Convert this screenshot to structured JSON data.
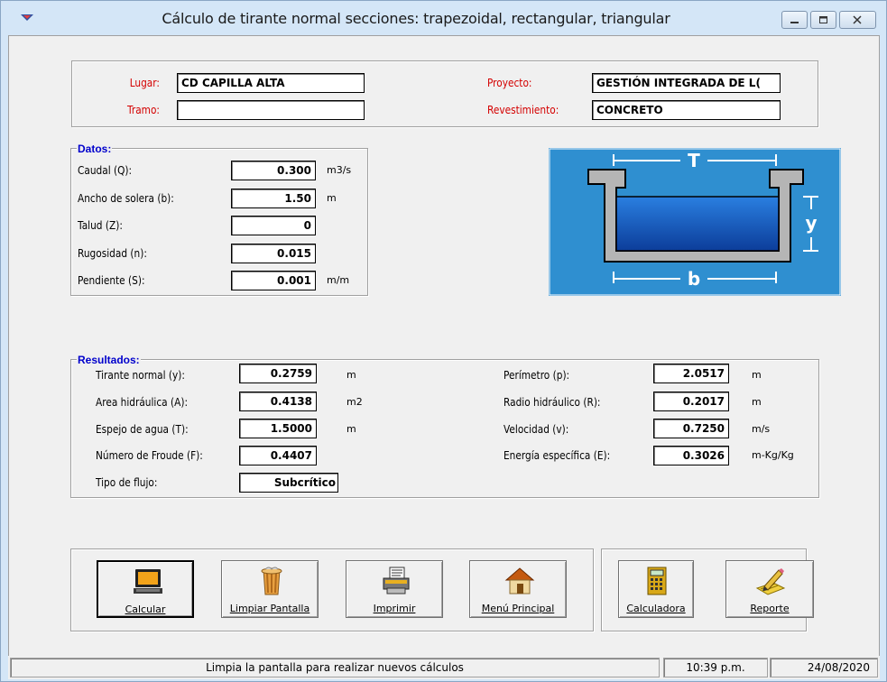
{
  "window": {
    "title": "Cálculo de tirante normal secciones: trapezoidal, rectangular, triangular"
  },
  "header": {
    "lugar_label": "Lugar:",
    "lugar_value": "CD CAPILLA ALTA",
    "tramo_label": "Tramo:",
    "tramo_value": "",
    "proyecto_label": "Proyecto:",
    "proyecto_value": "GESTIÓN INTEGRADA DE L(",
    "revestimiento_label": "Revestimiento:",
    "revestimiento_value": "CONCRETO"
  },
  "datos": {
    "legend": "Datos:",
    "caudal_label": "Caudal (Q):",
    "caudal_value": "0.300",
    "caudal_unit": "m3/s",
    "ancho_label": "Ancho de solera (b):",
    "ancho_value": "1.50",
    "ancho_unit": "m",
    "talud_label": "Talud (Z):",
    "talud_value": "0",
    "rugosidad_label": "Rugosidad (n):",
    "rugosidad_value": "0.015",
    "pendiente_label": "Pendiente (S):",
    "pendiente_value": "0.001",
    "pendiente_unit": "m/m"
  },
  "diagram": {
    "top_label": "T",
    "bottom_label": "b",
    "depth_label": "y"
  },
  "resultados": {
    "legend": "Resultados:",
    "tirante_label": "Tirante normal (y):",
    "tirante_value": "0.2759",
    "tirante_unit": "m",
    "area_label": "Area hidráulica (A):",
    "area_value": "0.4138",
    "area_unit": "m2",
    "espejo_label": "Espejo de agua (T):",
    "espejo_value": "1.5000",
    "espejo_unit": "m",
    "froude_label": "Número de Froude (F):",
    "froude_value": "0.4407",
    "flujo_label": "Tipo de flujo:",
    "flujo_value": "Subcrítico",
    "perimetro_label": "Perímetro (p):",
    "perimetro_value": "2.0517",
    "perimetro_unit": "m",
    "radio_label": "Radio hidráulico (R):",
    "radio_value": "0.2017",
    "radio_unit": "m",
    "velocidad_label": "Velocidad (v):",
    "velocidad_value": "0.7250",
    "velocidad_unit": "m/s",
    "energia_label": "Energía específica (E):",
    "energia_value": "0.3026",
    "energia_unit": "m-Kg/Kg"
  },
  "buttons": {
    "calcular": "Calcular",
    "limpiar": "Limpiar Pantalla",
    "imprimir": "Imprimir",
    "menu": "Menú Principal",
    "calculadora": "Calculadora",
    "reporte": "Reporte"
  },
  "status": {
    "message": "Limpia la pantalla para realizar nuevos cálculos",
    "time": "10:39 p.m.",
    "date": "24/08/2020"
  },
  "colors": {
    "legend": "#0000cc",
    "label_red": "#d40000",
    "diagram_bg": "#2f8fd0",
    "water": "#1758b8"
  },
  "icons": [
    "app-icon",
    "minimize-icon",
    "restore-icon",
    "close-icon",
    "laptop-icon",
    "trash-can-icon",
    "printer-icon",
    "house-icon",
    "calculator-icon",
    "pencil-notepad-icon"
  ]
}
